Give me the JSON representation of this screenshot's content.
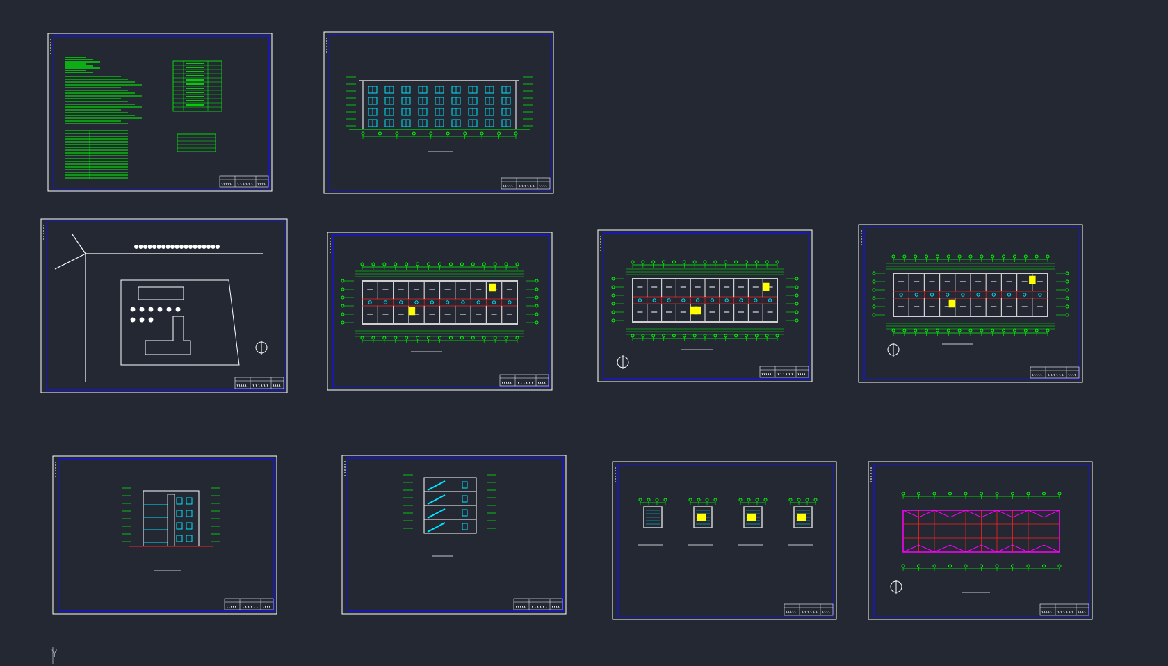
{
  "app": {
    "background_color": "#232833",
    "paper_border_color": "#ffffff",
    "inner_frame_color": "#1a1aa8",
    "accent_colors": {
      "grid_green": "#00ff00",
      "window_cyan": "#00e5ff",
      "axis_red": "#ff2020",
      "stair_yellow": "#ffff00",
      "roof_magenta": "#ff00ff"
    }
  },
  "sheets": [
    {
      "id": "sheet-01",
      "kind": "design-notes",
      "icon": "notes-table-icon"
    },
    {
      "id": "sheet-02",
      "kind": "front-elevation",
      "icon": "elevation-icon"
    },
    {
      "id": "sheet-03",
      "kind": "site-plan",
      "icon": "site-plan-icon"
    },
    {
      "id": "sheet-04",
      "kind": "floor-plan",
      "icon": "floor-plan-icon"
    },
    {
      "id": "sheet-05",
      "kind": "floor-plan",
      "icon": "floor-plan-icon"
    },
    {
      "id": "sheet-06",
      "kind": "floor-plan",
      "icon": "floor-plan-icon"
    },
    {
      "id": "sheet-07",
      "kind": "side-elevation",
      "icon": "elevation-icon"
    },
    {
      "id": "sheet-08",
      "kind": "section",
      "icon": "section-icon"
    },
    {
      "id": "sheet-09",
      "kind": "stair-details",
      "icon": "detail-icon"
    },
    {
      "id": "sheet-10",
      "kind": "roof-plan",
      "icon": "roof-plan-icon"
    }
  ],
  "ucs": {
    "y_axis_label": "Y",
    "icon": "ucs-icon"
  }
}
